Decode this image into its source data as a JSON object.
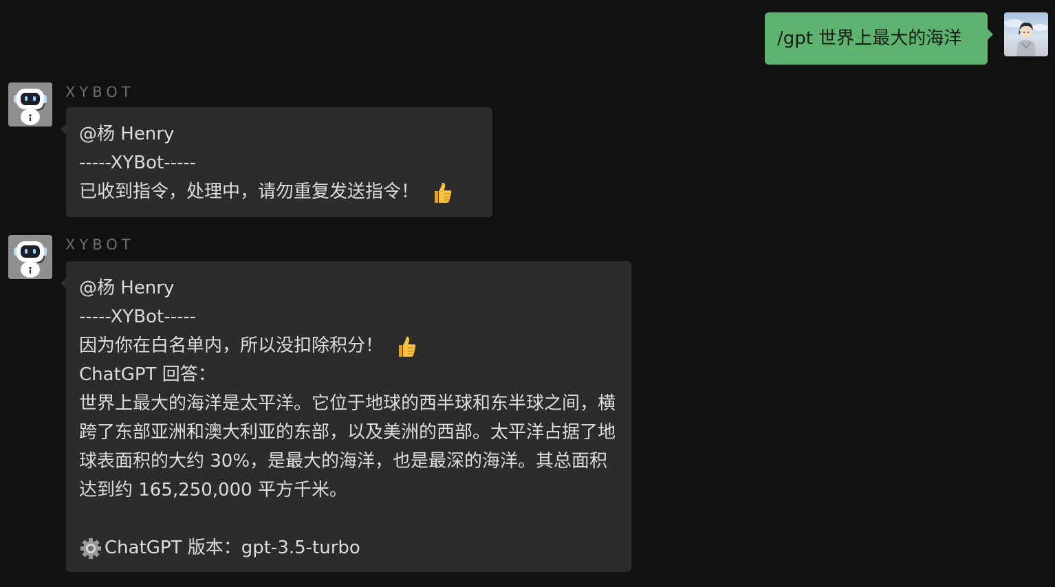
{
  "outgoing": {
    "text": "/gpt 世界上最大的海洋"
  },
  "messages": [
    {
      "sender": "XYBOT",
      "mention": "@杨 Henry",
      "separator": "-----XYBot-----",
      "status": "已收到指令，处理中，请勿重复发送指令！",
      "status_icon": "thumbs-up-icon"
    },
    {
      "sender": "XYBOT",
      "mention": "@杨 Henry",
      "separator": "-----XYBot-----",
      "note": "因为你在白名单内，所以没扣除积分！",
      "note_icon": "thumbs-up-icon",
      "answer_label": "ChatGPT 回答：",
      "answer": "世界上最大的海洋是太平洋。它位于地球的西半球和东半球之间，横跨了东部亚洲和澳大利亚的东部，以及美洲的西部。太平洋占据了地球表面积的大约 30%，是最大的海洋，也是最深的海洋。其总面积达到约 165,250,000 平方千米。",
      "version": "ChatGPT 版本：gpt-3.5-turbo",
      "version_icon": "gear-icon"
    }
  ],
  "colors": {
    "background": "#111111",
    "incoming_bubble": "#2c2c2c",
    "outgoing_bubble": "#5fb370"
  }
}
